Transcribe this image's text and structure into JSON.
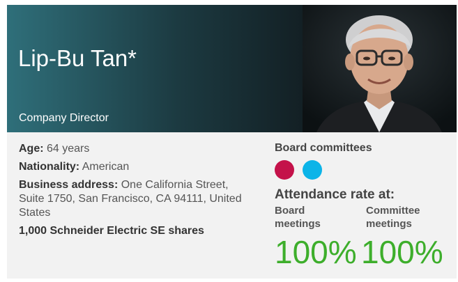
{
  "profile": {
    "name": "Lip-Bu Tan*",
    "role": "Company Director"
  },
  "details": {
    "age_label": "Age:",
    "age_value": "64 years",
    "nationality_label": "Nationality:",
    "nationality_value": "American",
    "address_label": "Business address:",
    "address_value": "One California Street, Suite 1750, San Francisco, CA 94111, United States",
    "shares": "1,000 Schneider Electric SE shares"
  },
  "committees": {
    "title": "Board committees",
    "colors": [
      "#c4124a",
      "#0cb4e8"
    ]
  },
  "attendance": {
    "title": "Attendance rate at:",
    "board_label": "Board meetings",
    "committee_label": "Committee meetings",
    "board_value": "100%",
    "committee_value": "100%"
  },
  "colors": {
    "accent_green": "#3dae2b",
    "header_dark": "#111a1e"
  }
}
